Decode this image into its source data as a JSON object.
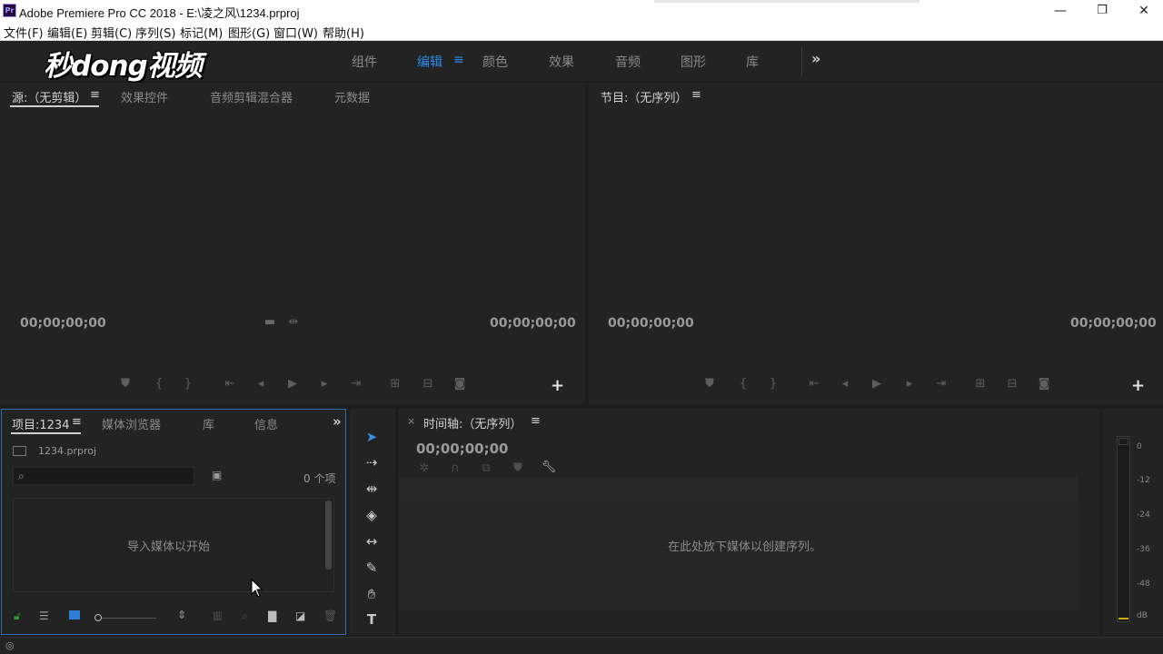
{
  "window": {
    "title": "Adobe Premiere Pro CC 2018 - E:\\凌之风\\1234.prproj",
    "app_icon": "Pr",
    "minimize": "—",
    "restore": "❐",
    "close": "✕"
  },
  "menu": [
    "文件(F)",
    "编辑(E)",
    "剪辑(C)",
    "序列(S)",
    "标记(M)",
    "图形(G)",
    "窗口(W)",
    "帮助(H)"
  ],
  "watermark": "秒dong视频",
  "workspaces": {
    "tabs": [
      "组件",
      "编辑",
      "颜色",
      "效果",
      "音频",
      "图形",
      "库"
    ],
    "active": "编辑",
    "more": "»"
  },
  "source_panel": {
    "tabs": [
      "源:（无剪辑）",
      "效果控件",
      "音频剪辑混合器",
      "元数据"
    ],
    "timecode_left": "00;00;00;00",
    "timecode_right": "00;00;00;00"
  },
  "program_panel": {
    "tab": "节目:（无序列）",
    "timecode_left": "00;00;00;00",
    "timecode_right": "00;00;00;00"
  },
  "project_panel": {
    "tabs": [
      "项目:1234",
      "媒体浏览器",
      "库",
      "信息"
    ],
    "more": "»",
    "file": "1234.prproj",
    "search_placeholder": "",
    "item_count": "0 个项",
    "empty_text": "导入媒体以开始"
  },
  "timeline_panel": {
    "close": "×",
    "tab": "时间轴:（无序列）",
    "timecode": "00;00;00;00",
    "drop_text": "在此处放下媒体以创建序列。"
  },
  "audio_meter": {
    "labels": [
      "0",
      "-12",
      "-24",
      "-36",
      "-48",
      "dB"
    ]
  },
  "colors": {
    "accent": "#2d8ceb",
    "panel_bg": "#232323",
    "app_bg": "#1d1d1d"
  }
}
